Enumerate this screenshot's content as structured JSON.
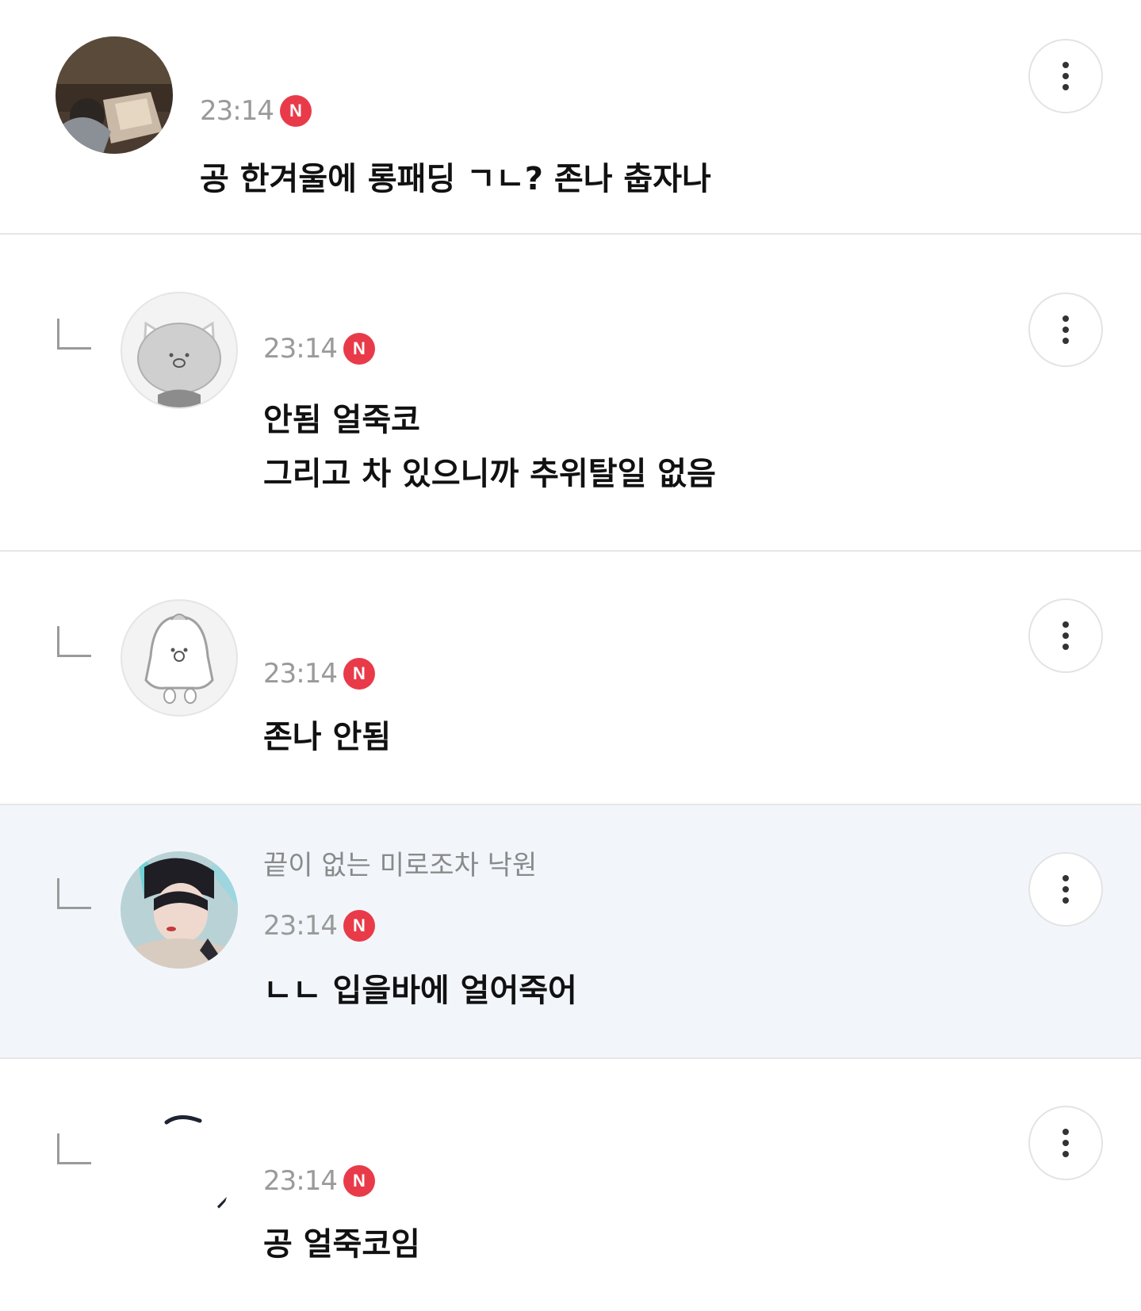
{
  "comments": [
    {
      "nickname": "",
      "time": "23:14",
      "badge": "N",
      "body": "공 한겨울에 롱패딩 ㄱㄴ? 존나 춥자나",
      "avatar": "photo-avatar",
      "reply": false
    },
    {
      "nickname": "",
      "time": "23:14",
      "badge": "N",
      "body": "안됨 얼죽코\n그리고 차 있으니까 추위탈일 없음",
      "avatar": "cat-avatar",
      "reply": true
    },
    {
      "nickname": "",
      "time": "23:14",
      "badge": "N",
      "body": "존나 안됨",
      "avatar": "penguin-avatar",
      "reply": true
    },
    {
      "nickname": "끝이 없는 미로조차 낙원",
      "time": "23:14",
      "badge": "N",
      "body": "ㄴㄴ 입을바에 얼어죽어",
      "avatar": "photo-avatar",
      "reply": true
    },
    {
      "nickname": "",
      "time": "23:14",
      "badge": "N",
      "body": "공 얼죽코임",
      "avatar": "photo-avatar",
      "reply": true
    }
  ],
  "icons": {
    "more": "more-vertical-icon",
    "reply": "reply-corner-icon",
    "new": "new-badge"
  },
  "colors": {
    "badge": "#e93a49",
    "highlight": "#f2f6fb",
    "time": "#9a9a9a",
    "nickname": "#8a8a8a"
  }
}
